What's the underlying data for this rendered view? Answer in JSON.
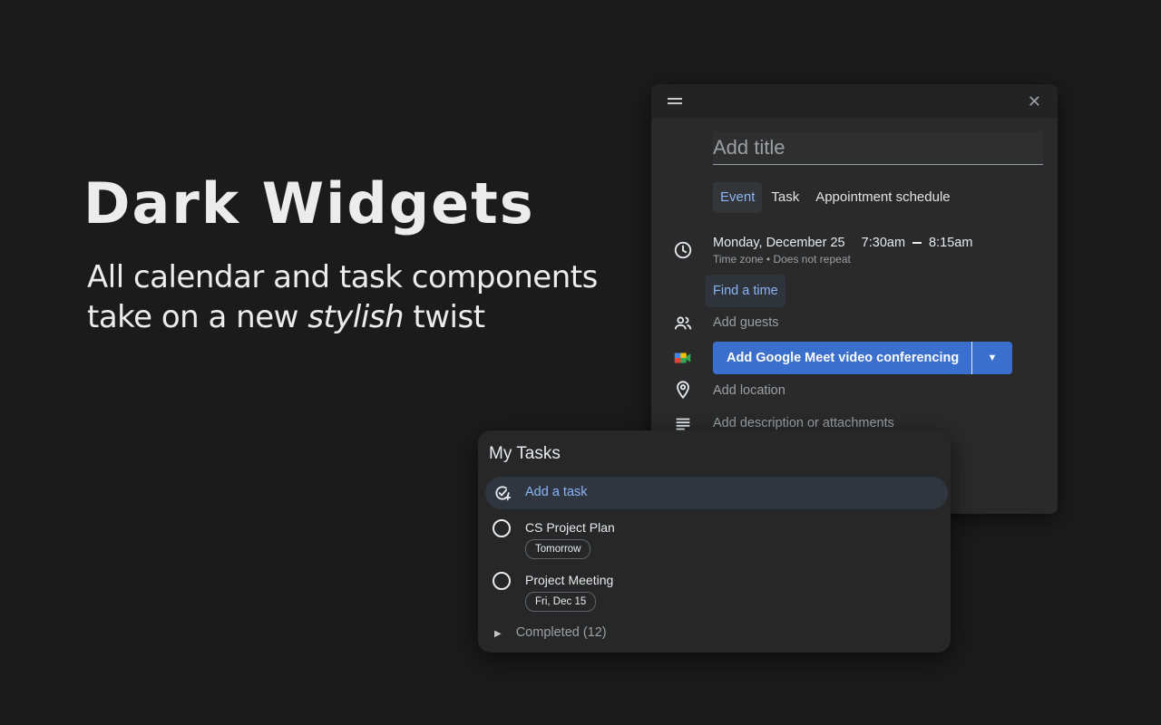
{
  "hero": {
    "title": "Dark Widgets",
    "subtitle_line1": "All calendar and task components",
    "subtitle_line2_pre": "take on a new ",
    "subtitle_line2_em": "stylish",
    "subtitle_line2_post": " twist"
  },
  "event_dialog": {
    "title_placeholder": "Add title",
    "tabs": [
      {
        "label": "Event",
        "active": true
      },
      {
        "label": "Task",
        "active": false
      },
      {
        "label": "Appointment schedule",
        "active": false
      }
    ],
    "date": "Monday, December 25",
    "start_time": "7:30am",
    "end_time": "8:15am",
    "date_sub": "Time zone • Does not repeat",
    "find_time": "Find a time",
    "add_guests": "Add guests",
    "meet_button": "Add Google Meet video conferencing",
    "add_location": "Add location",
    "add_description": "Add description or attachments"
  },
  "tasks": {
    "title": "My Tasks",
    "add_task": "Add a task",
    "items": [
      {
        "name": "CS Project Plan",
        "due": "Tomorrow"
      },
      {
        "name": "Project Meeting",
        "due": "Fri, Dec 15"
      }
    ],
    "completed": "Completed (12)"
  },
  "colors": {
    "background": "#1b1b1b",
    "panel": "#2a2a2a",
    "accent": "#8ab4f8",
    "meet_button": "#3b6fce"
  }
}
